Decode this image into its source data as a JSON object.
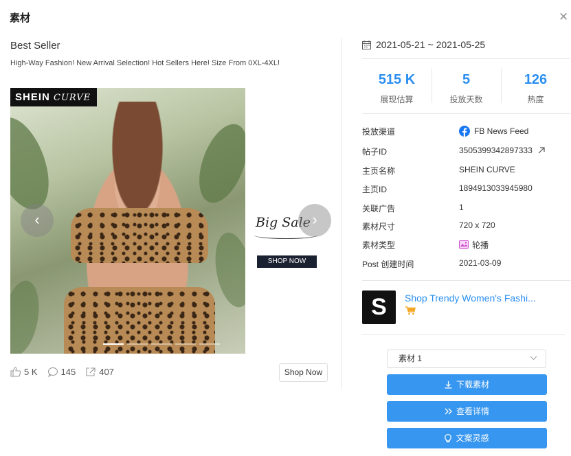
{
  "dialog": {
    "title": "素材",
    "close_icon": "close-icon"
  },
  "ad": {
    "title": "Best Seller",
    "text": "High-Way Fashion! New Arrival Selection! Hot Sellers Here! Size From 0XL-4XL!",
    "brand_overlay_text": "SHEIN",
    "brand_overlay_script": "CURVE",
    "slide2_text": "Big Sale",
    "slide2_button": "SHOP NOW",
    "likes": "5 K",
    "comments": "145",
    "shares": "407",
    "cta": "Shop Now"
  },
  "date_range": "2021-05-21 ~ 2021-05-25",
  "metrics": [
    {
      "value": "515 K",
      "label": "展现估算"
    },
    {
      "value": "5",
      "label": "投放天数"
    },
    {
      "value": "126",
      "label": "热度"
    }
  ],
  "info": [
    {
      "key": "投放渠道",
      "value": "FB News Feed"
    },
    {
      "key": "帖子ID",
      "value": "3505399342897333"
    },
    {
      "key": "主页名称",
      "value": "SHEIN CURVE"
    },
    {
      "key": "主页ID",
      "value": "1894913033945980"
    },
    {
      "key": "关联广告",
      "value": "1"
    },
    {
      "key": "素材尺寸",
      "value": "720 x 720"
    },
    {
      "key": "素材类型",
      "value": "轮播"
    },
    {
      "key": "Post 创建时间",
      "value": "2021-03-09"
    }
  ],
  "product": {
    "logo_letter": "S",
    "name": "Shop Trendy Women's Fashi..."
  },
  "select": {
    "value": "素材 1"
  },
  "buttons": {
    "download": "下载素材",
    "details": "查看详情",
    "inspire": "文案灵感"
  },
  "colors": {
    "accent": "#2a8ff0",
    "button": "#3796ef",
    "facebook": "#1877f2",
    "media_type": "#d04fd0",
    "cart": "#f5a623"
  }
}
